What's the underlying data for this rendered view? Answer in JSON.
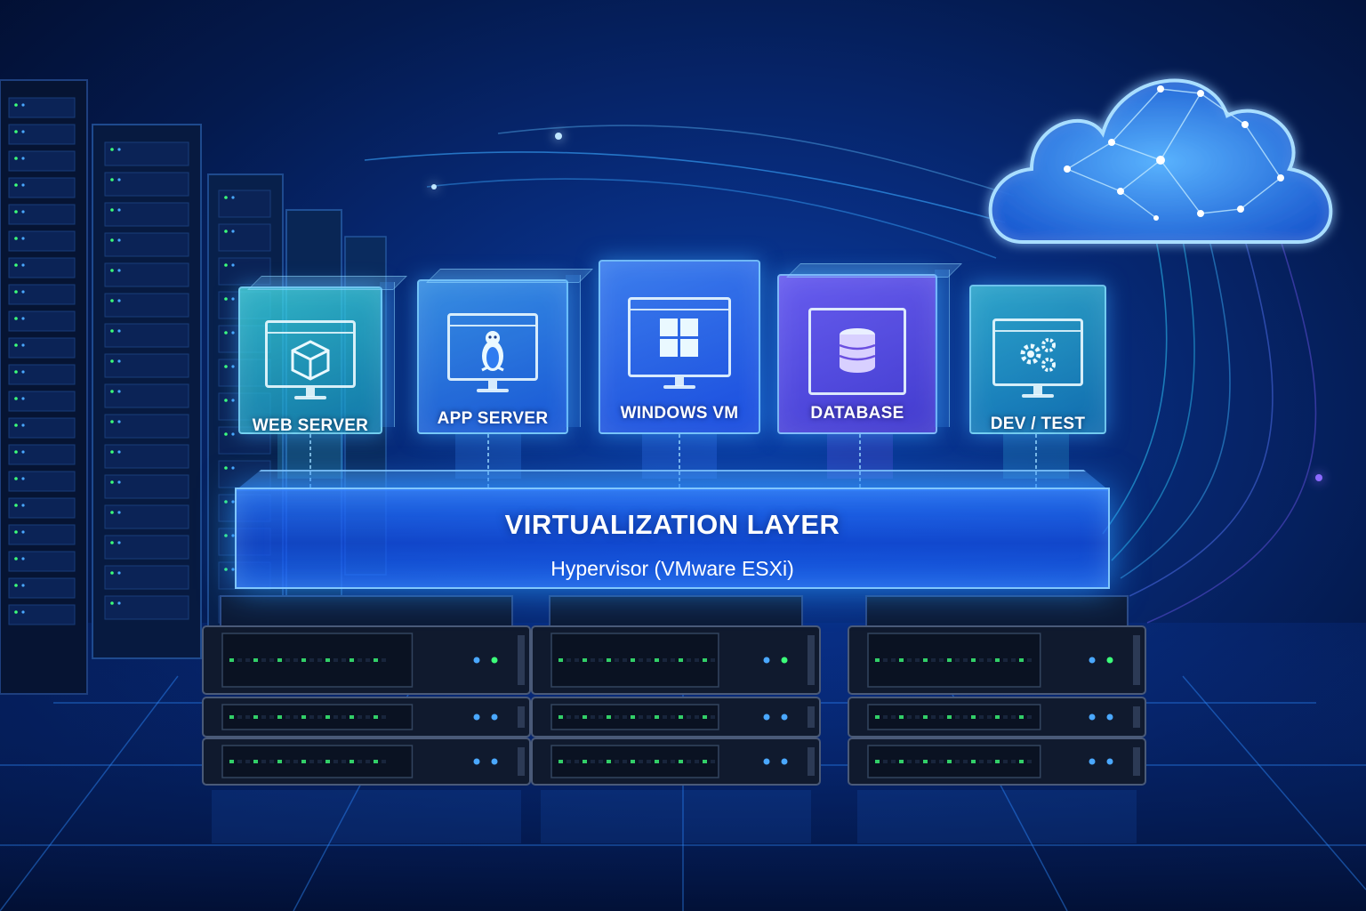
{
  "vms": [
    {
      "label": "WEB SERVER",
      "icon": "cube-monitor-icon",
      "color": "#1fb6c8"
    },
    {
      "label": "APP SERVER",
      "icon": "linux-penguin-icon",
      "color": "#2f7cf0"
    },
    {
      "label": "WINDOWS VM",
      "icon": "windows-logo-icon",
      "color": "#2a5fe8"
    },
    {
      "label": "DATABASE",
      "icon": "database-icon",
      "color": "#6a4fe0"
    },
    {
      "label": "DEV / TEST",
      "icon": "gears-icon",
      "color": "#20a6c0"
    }
  ],
  "virtualization": {
    "title": "VIRTUALIZATION LAYER",
    "subtitle": "Hypervisor (VMware ESXi)"
  },
  "colors": {
    "background": "#041a4e",
    "glow": "#3aa0ff",
    "led_green": "#3cff7a",
    "led_blue": "#4aa8ff"
  }
}
